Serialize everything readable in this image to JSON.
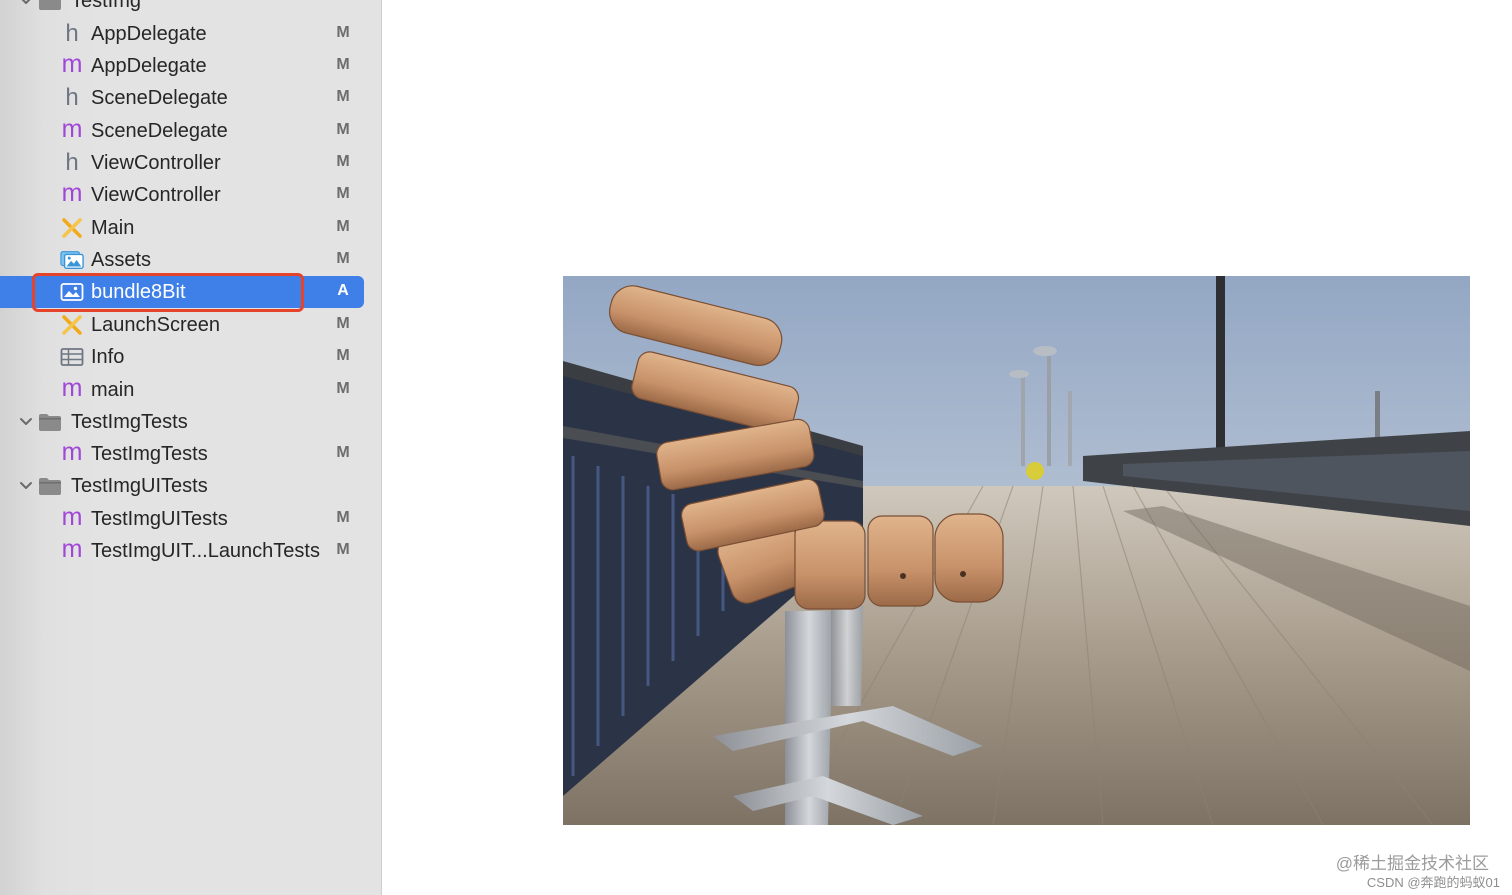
{
  "navigator": {
    "rows": [
      {
        "label": "TestImg",
        "kind": "group",
        "icon": "folder-icon",
        "status": ""
      },
      {
        "label": "AppDelegate",
        "kind": "header",
        "icon": "header-file-icon",
        "status": "M"
      },
      {
        "label": "AppDelegate",
        "kind": "implementation",
        "icon": "objc-file-icon",
        "status": "M"
      },
      {
        "label": "SceneDelegate",
        "kind": "header",
        "icon": "header-file-icon",
        "status": "M"
      },
      {
        "label": "SceneDelegate",
        "kind": "implementation",
        "icon": "objc-file-icon",
        "status": "M"
      },
      {
        "label": "ViewController",
        "kind": "header",
        "icon": "header-file-icon",
        "status": "M"
      },
      {
        "label": "ViewController",
        "kind": "implementation",
        "icon": "objc-file-icon",
        "status": "M"
      },
      {
        "label": "Main",
        "kind": "storyboard",
        "icon": "storyboard-icon",
        "status": "M"
      },
      {
        "label": "Assets",
        "kind": "assets",
        "icon": "asset-catalog-icon",
        "status": "M"
      },
      {
        "label": "bundle8Bit",
        "kind": "image",
        "icon": "image-file-icon",
        "status": "A",
        "selected": true
      },
      {
        "label": "LaunchScreen",
        "kind": "storyboard",
        "icon": "storyboard-icon",
        "status": "M"
      },
      {
        "label": "Info",
        "kind": "plist",
        "icon": "plist-icon",
        "status": "M"
      },
      {
        "label": "main",
        "kind": "implementation",
        "icon": "objc-file-icon",
        "status": "M"
      },
      {
        "label": "TestImgTests",
        "kind": "group",
        "icon": "folder-icon",
        "status": ""
      },
      {
        "label": "TestImgTests",
        "kind": "implementation",
        "icon": "objc-file-icon",
        "status": "M"
      },
      {
        "label": "TestImgUITests",
        "kind": "group",
        "icon": "folder-icon",
        "status": ""
      },
      {
        "label": "TestImgUITests",
        "kind": "implementation",
        "icon": "objc-file-icon",
        "status": "M"
      },
      {
        "label": "TestImgUIT...LaunchTests",
        "kind": "implementation",
        "icon": "objc-file-icon",
        "status": "M"
      }
    ]
  },
  "colors": {
    "selection": "#3f7fe8",
    "highlight_outline": "#e5432a",
    "objc_m": "#a046d8",
    "storyboard": "#f2a91a"
  },
  "preview": {
    "subject": "park-bench-on-boardwalk-photo"
  },
  "watermark": {
    "line1": "@稀土掘金技术社区",
    "line2": "CSDN @奔跑的蚂蚁01"
  }
}
